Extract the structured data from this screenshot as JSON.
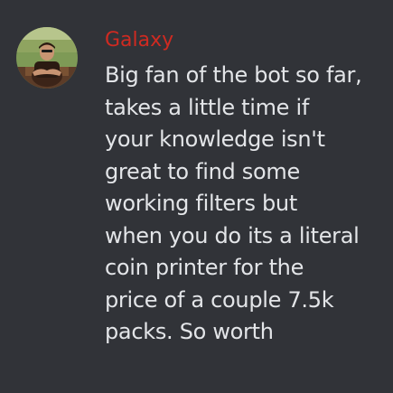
{
  "message": {
    "author": "Galaxy",
    "author_color": "#cf2a21",
    "avatar_icon": "user-avatar-photo",
    "lines": [
      "Big fan of the bot so far,",
      "takes a little time if",
      "your knowledge isn't",
      "great to find some",
      "working filters but",
      "when you do its a literal",
      "coin printer for the",
      "price of a couple 7.5k",
      "packs. So worth"
    ]
  },
  "theme": {
    "background": "#313338",
    "text": "#e3e5e8"
  }
}
